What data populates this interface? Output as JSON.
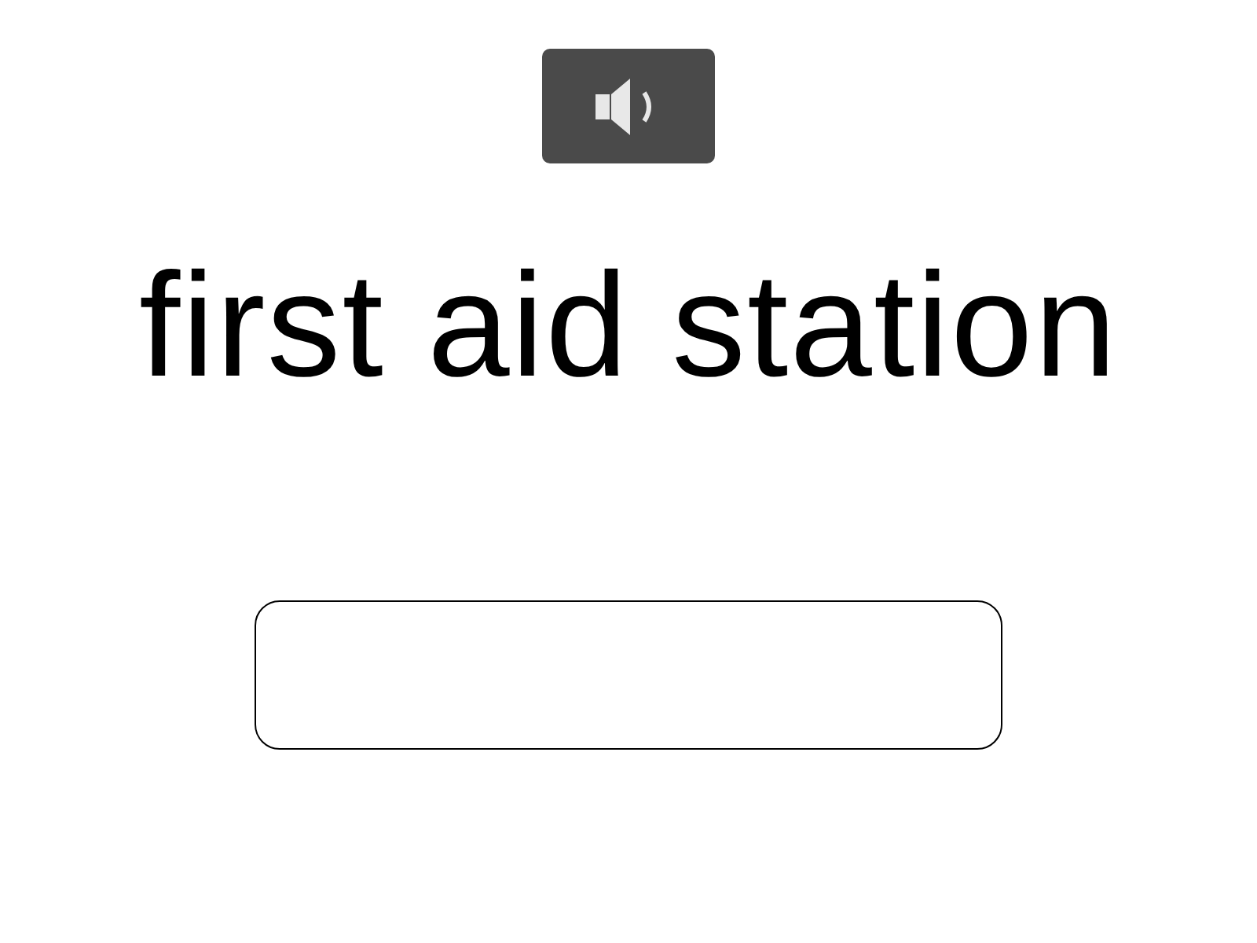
{
  "word": "first aid station"
}
